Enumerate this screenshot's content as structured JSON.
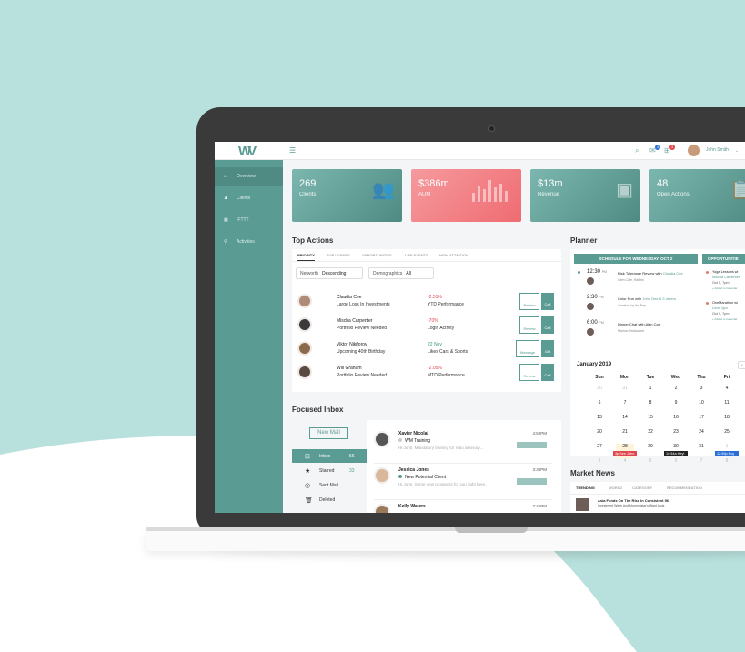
{
  "colors": {
    "accent": "#5a9b93",
    "card_teal": "#5a9b93",
    "card_red": "#f0737a",
    "danger": "#e0464e",
    "success": "#3a9a6c"
  },
  "header": {
    "logo": "W",
    "menu_icon": "hamburger-icon",
    "user_name": "John Smith",
    "notif_count": "4",
    "cart_count": "3"
  },
  "sidebar": {
    "items": [
      {
        "label": "Overview",
        "icon": "home-icon"
      },
      {
        "label": "Clients",
        "icon": "users-icon"
      },
      {
        "label": "IFTTT",
        "icon": "calendar-icon"
      },
      {
        "label": "Activities",
        "icon": "pin-icon"
      }
    ]
  },
  "cards": [
    {
      "value": "269",
      "label": "Clients",
      "icon": "people-icon"
    },
    {
      "value": "$386m",
      "label": "AUM",
      "icon": "bar-icon"
    },
    {
      "value": "$13m",
      "label": "Revenue",
      "icon": "money-icon"
    },
    {
      "value": "48",
      "label": "Open Actions",
      "icon": "clipboard-icon"
    }
  ],
  "top_actions": {
    "title": "Top Actions",
    "tabs": [
      "PRIORITY",
      "TOP LOSERS",
      "OPPORTUNITIES",
      "LIFE EVENTS",
      "HIGH ATTRITION"
    ],
    "filters": [
      {
        "label": "Networth",
        "value": "Descending"
      },
      {
        "label": "Demographics",
        "value": "All"
      }
    ],
    "rows": [
      {
        "name": "Claudia Cee",
        "desc": "Large Loss In Investments",
        "v1": "-2.51%",
        "v2": "YTD Performance",
        "b1": "Review",
        "b2": "Call",
        "tone": "red"
      },
      {
        "name": "Mischa Carpenter",
        "desc": "Portfolio Review Needed",
        "v1": "-70%",
        "v2": "Login Activity",
        "b1": "Review",
        "b2": "Call",
        "tone": "red"
      },
      {
        "name": "Viktor Nikiforov",
        "desc": "Upcoming 40th Birthday",
        "v1": "22 Nov",
        "v2": "Likes Cars & Sports",
        "b1": "Message",
        "b2": "Gift",
        "tone": "grn"
      },
      {
        "name": "Will Graham",
        "desc": "Portfolio Review Needed",
        "v1": "-2.05%",
        "v2": "MTD Performance",
        "b1": "Review",
        "b2": "Call",
        "tone": "red"
      }
    ]
  },
  "inbox": {
    "title": "Focused Inbox",
    "new_mail": "New Mail",
    "folders": [
      {
        "label": "Inbox",
        "count": "56",
        "icon": "inbox-icon"
      },
      {
        "label": "Starred",
        "count": "33",
        "icon": "star-icon"
      },
      {
        "label": "Sent Mail",
        "count": "",
        "icon": "check-circle-icon"
      },
      {
        "label": "Deleted",
        "count": "",
        "icon": "trash-icon"
      }
    ],
    "mails": [
      {
        "name": "Xavier Nicolai",
        "subject": "WM Training",
        "preview": "Hi John, Mandatory training for  robo advisory...",
        "time": "4:52PM",
        "dot": "#cccccc"
      },
      {
        "name": "Jessica Jones",
        "subject": "New Potential Client",
        "preview": "Hi John, Some new prospects for you right here...",
        "time": "3:30PM",
        "dot": "#5a9b93"
      },
      {
        "name": "Kelly Waters",
        "subject": "",
        "preview": "",
        "time": "2:45PM",
        "dot": "#cccccc"
      }
    ]
  },
  "planner": {
    "title": "Planner",
    "schedule_header": "SCHEDULE FOR WEDNESDAY, OCT 2",
    "opp_header": "OPPORTUNITIE",
    "events": [
      {
        "time": "12:30",
        "ampm": "PM",
        "title": "Risk Tolerance Review with ",
        "who": "Claudia Cee",
        "sub": "Gem Cafe, Raffles"
      },
      {
        "time": "2:30",
        "ampm": "PM",
        "title": "Color Run with ",
        "who": "John Dee & 3 others",
        "sub": "Gardens by the Bay"
      },
      {
        "time": "6:00",
        "ampm": "PM",
        "title": "Dinner Chat with Alan Carr",
        "who": "",
        "sub": "Marina Restaurant"
      }
    ],
    "opps": [
      {
        "title": "Yoga Lessons wi",
        "who": "Mischa Carpenter",
        "date": "Oct 5, 7pm",
        "add": "+ Added to Calendar"
      },
      {
        "title": "OneMarathon wi",
        "who": "Lenin Igor",
        "date": "Oct 9, 7pm",
        "add": "+ Added to Calendar"
      }
    ],
    "month": "January 2019",
    "days": [
      "Sun",
      "Mon",
      "Tue",
      "Wed",
      "Thu",
      "Fri"
    ],
    "weeks": [
      [
        "30",
        "31",
        "1",
        "2",
        "3",
        "4"
      ],
      [
        "6",
        "7",
        "8",
        "9",
        "10",
        "11"
      ],
      [
        "13",
        "14",
        "15",
        "16",
        "17",
        "18"
      ],
      [
        "20",
        "21",
        "22",
        "23",
        "24",
        "25"
      ],
      [
        "27",
        "28",
        "29",
        "30",
        "31",
        "1"
      ],
      [
        "3",
        "4",
        "5",
        "6",
        "7",
        "8"
      ]
    ],
    "cal_events": [
      {
        "text": "3p See John",
        "color": "#e0464e"
      },
      {
        "text": "10:54a Hey!",
        "color": "#222222"
      },
      {
        "text": "12:59p Buy",
        "color": "#2b6fd6"
      }
    ]
  },
  "news": {
    "title": "Market News",
    "tabs": [
      "TRENDING",
      "WORLD",
      "CATEGORY",
      "RECOMMENDATION"
    ],
    "headline": "Asia Funds On The Rise In Consistent 56",
    "sub": "Investment Week And Morningstar's Want Look"
  }
}
